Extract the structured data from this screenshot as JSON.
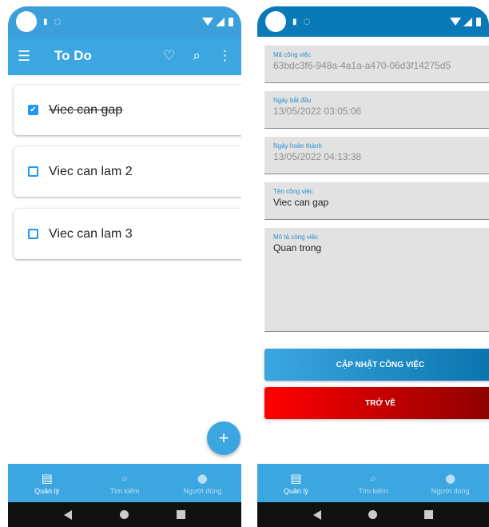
{
  "left": {
    "app_title": "To Do",
    "todos": [
      {
        "text": "Viec can gap",
        "checked": true
      },
      {
        "text": "Viec can lam 2",
        "checked": false
      },
      {
        "text": "Viec can lam 3",
        "checked": false
      }
    ],
    "fab_label": "+"
  },
  "right": {
    "fields": [
      {
        "label": "Mã công việc",
        "value": "63bdc3f6-948a-4a1a-a470-06d3f14275d5"
      },
      {
        "label": "Ngày bắt đầu",
        "value": "13/05/2022 03:05:06"
      },
      {
        "label": "Ngày hoàn thành",
        "value": "13/05/2022 04:13:38"
      },
      {
        "label": "Tên công việc",
        "value": "Viec can gap"
      },
      {
        "label": "Mô tả công việc",
        "value": "Quan trong"
      }
    ],
    "update_button": "CẬP NHẬT CÔNG VIỆC",
    "back_button": "TRỞ VỀ"
  },
  "bottom_nav": [
    {
      "label": "Quản lý",
      "icon": "calendar-icon"
    },
    {
      "label": "Tìm kiếm",
      "icon": "search-icon"
    },
    {
      "label": "Người dùng",
      "icon": "person-icon"
    }
  ],
  "colors": {
    "primary": "#3ba6e0",
    "checkbox": "#2196f3",
    "danger": "#ff0000"
  }
}
